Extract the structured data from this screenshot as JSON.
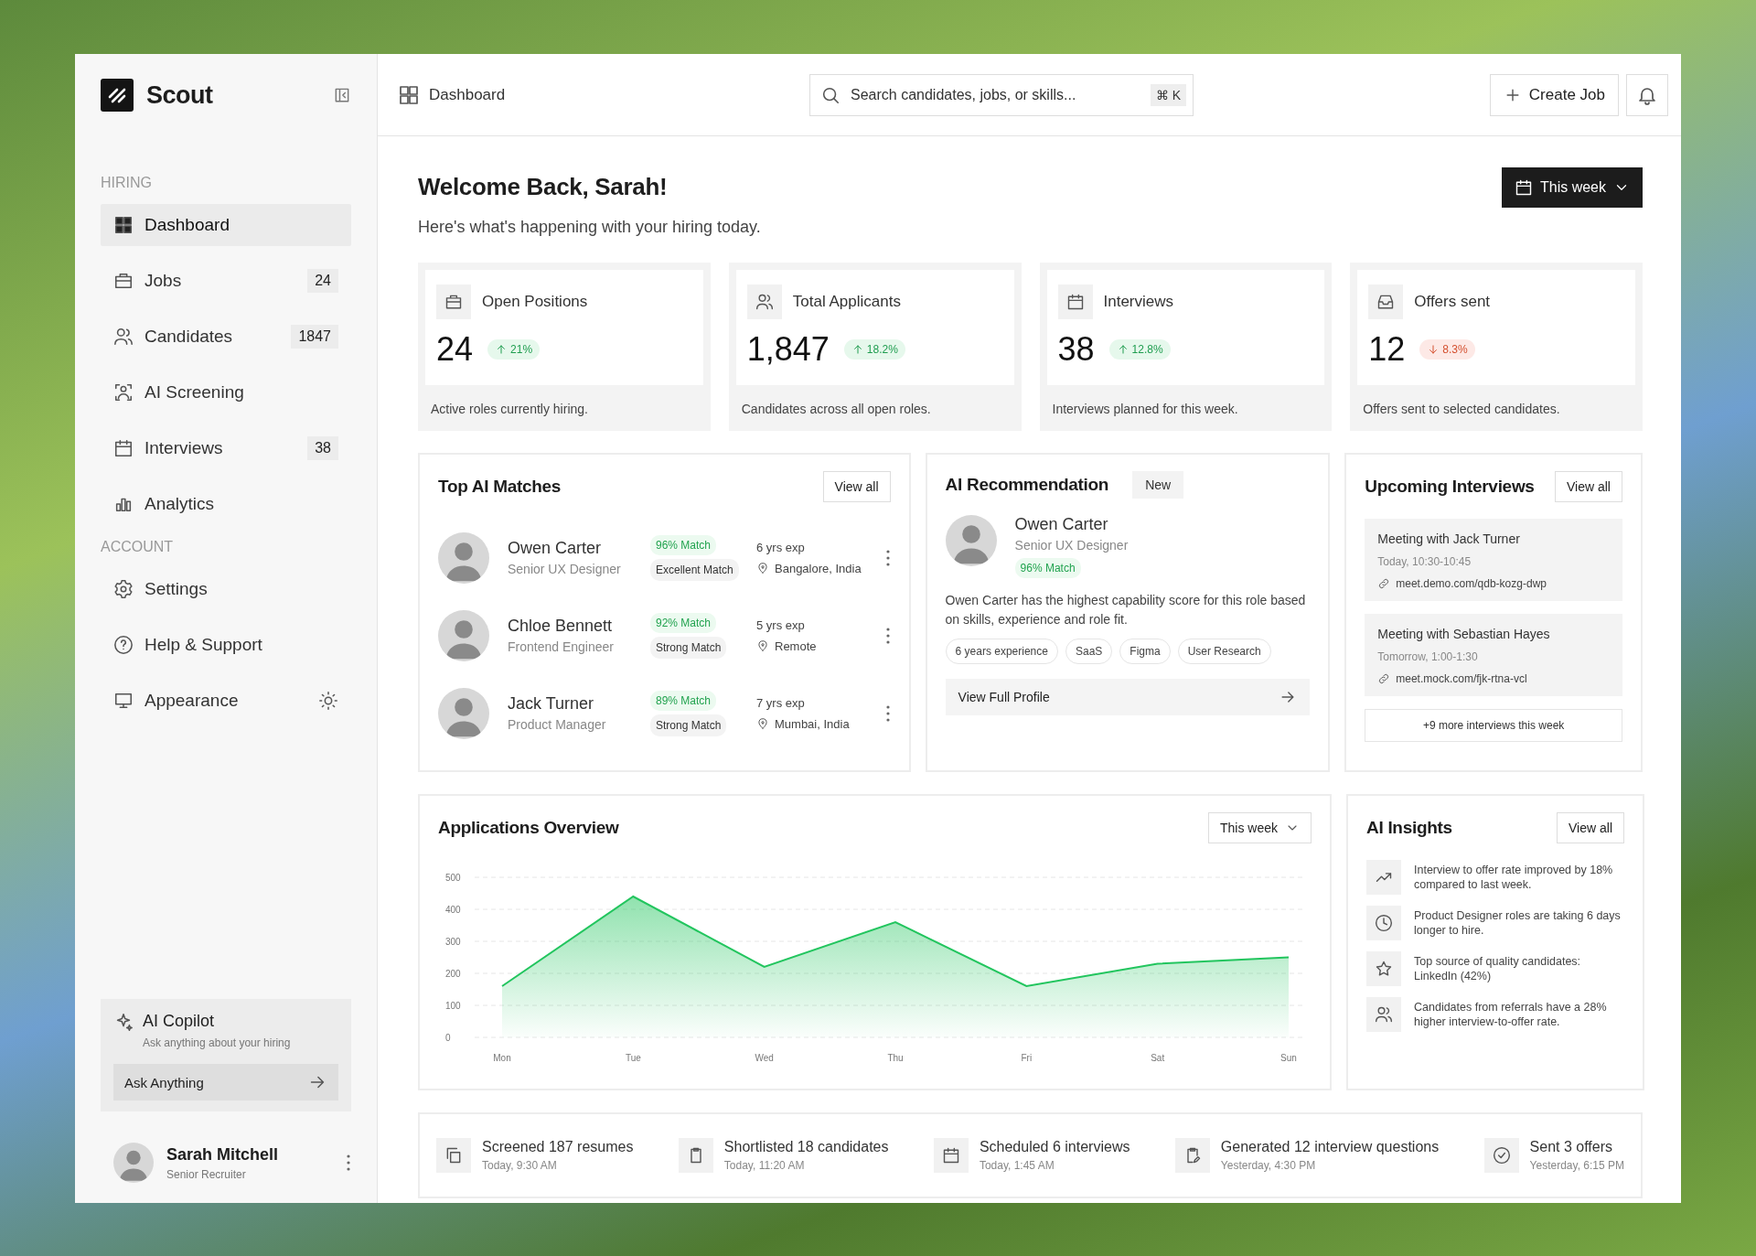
{
  "sidebar": {
    "brand": "Scout",
    "sections": [
      {
        "heading": "HIRING",
        "items": [
          {
            "label": "Dashboard",
            "selected": true
          },
          {
            "label": "Jobs",
            "count": "24",
            "selected": false
          },
          {
            "label": "Candidates",
            "count": "1847",
            "selected": false
          },
          {
            "label": "AI Screening",
            "selected": false
          },
          {
            "label": "Interviews",
            "count": "38",
            "selected": false
          },
          {
            "label": "Analytics",
            "selected": false
          }
        ]
      },
      {
        "heading": "ACCOUNT",
        "items": [
          {
            "label": "Settings",
            "selected": false
          },
          {
            "label": "Help & Support",
            "selected": false
          },
          {
            "label": "Appearance",
            "selected": false
          }
        ]
      }
    ],
    "copilot": {
      "title": "AI Copilot",
      "subtitle": "Ask anything about your hiring",
      "placeholder": "Ask Anything"
    },
    "user": {
      "name": "Sarah Mitchell",
      "role": "Senior Recruiter"
    }
  },
  "header": {
    "breadcrumb": "Dashboard",
    "search": {
      "placeholder": "Search candidates, jobs, or skills...",
      "shortcut": "⌘ K"
    },
    "create_button": "Create Job"
  },
  "welcome": {
    "title": "Welcome Back, Sarah!",
    "subtitle": "Here's what's happening with your hiring today.",
    "period": "This week"
  },
  "stats": [
    {
      "label": "Open Positions",
      "value": "24",
      "change": "21%",
      "kind": "up",
      "description": "Active roles currently hiring."
    },
    {
      "label": "Total Applicants",
      "value": "1,847",
      "change": "18.2%",
      "kind": "up",
      "description": "Candidates across all open roles."
    },
    {
      "label": "Interviews",
      "value": "38",
      "change": "12.8%",
      "kind": "up",
      "description": "Interviews planned for this week."
    },
    {
      "label": "Offers sent",
      "value": "12",
      "change": "8.3%",
      "kind": "down",
      "description": "Offers sent to selected candidates."
    }
  ],
  "top_matches": {
    "title": "Top AI Matches",
    "view_all": "View all",
    "candidates": [
      {
        "name": "Owen Carter",
        "role": "Senior UX Designer",
        "match": "96% Match",
        "match_label": "Excellent Match",
        "experience": "6 yrs exp",
        "location": "Bangalore, India"
      },
      {
        "name": "Chloe Bennett",
        "role": "Frontend Engineer",
        "match": "92% Match",
        "match_label": "Strong Match",
        "experience": "5 yrs exp",
        "location": "Remote"
      },
      {
        "name": "Jack Turner",
        "role": "Product Manager",
        "match": "89% Match",
        "match_label": "Strong Match",
        "experience": "7 yrs exp",
        "location": "Mumbai, India"
      }
    ]
  },
  "recommendation": {
    "title": "AI Recommendation",
    "badge": "New",
    "name": "Owen Carter",
    "role": "Senior UX Designer",
    "match": "96% Match",
    "description": "Owen Carter has the highest capability score for this role based on skills, experience and role fit.",
    "tags": [
      "6 years experience",
      "SaaS",
      "Figma",
      "User Research"
    ],
    "button": "View Full Profile"
  },
  "upcoming_interviews": {
    "title": "Upcoming Interviews",
    "view_all": "View all",
    "meetings": [
      {
        "title": "Meeting with Jack Turner",
        "time": "Today, 10:30-10:45",
        "link": "meet.demo.com/qdb-kozg-dwp"
      },
      {
        "title": "Meeting with Sebastian Hayes",
        "time": "Tomorrow, 1:00-1:30",
        "link": "meet.mock.com/fjk-rtna-vcl"
      }
    ],
    "more": "+9 more interviews this week"
  },
  "applications_overview": {
    "title": "Applications Overview",
    "period": "This week",
    "chart_data": {
      "type": "area",
      "categories": [
        "Mon",
        "Tue",
        "Wed",
        "Thu",
        "Fri",
        "Sat",
        "Sun"
      ],
      "series": [
        {
          "color": "#22c55e",
          "values": [
            160,
            440,
            220,
            360,
            160,
            230,
            250
          ]
        }
      ],
      "ylim": [
        0,
        500
      ],
      "yticks": [
        0,
        100,
        200,
        300,
        400,
        500
      ],
      "grid": true
    }
  },
  "ai_insights": {
    "title": "AI Insights",
    "view_all": "View all",
    "items": [
      "Interview to offer rate improved by 18% compared to last week.",
      "Product Designer roles are taking 6 days longer to hire.",
      "Top source of quality candidates: LinkedIn (42%)",
      "Candidates from referrals have a 28% higher interview-to-offer rate."
    ]
  },
  "activity": [
    {
      "title": "Screened 187 resumes",
      "time": "Today, 9:30 AM"
    },
    {
      "title": "Shortlisted 18 candidates",
      "time": "Today, 11:20 AM"
    },
    {
      "title": "Scheduled 6 interviews",
      "time": "Today, 1:45 AM"
    },
    {
      "title": "Generated 12 interview questions",
      "time": "Yesterday, 4:30 PM"
    },
    {
      "title": "Sent 3 offers",
      "time": "Yesterday, 6:15 PM"
    }
  ]
}
